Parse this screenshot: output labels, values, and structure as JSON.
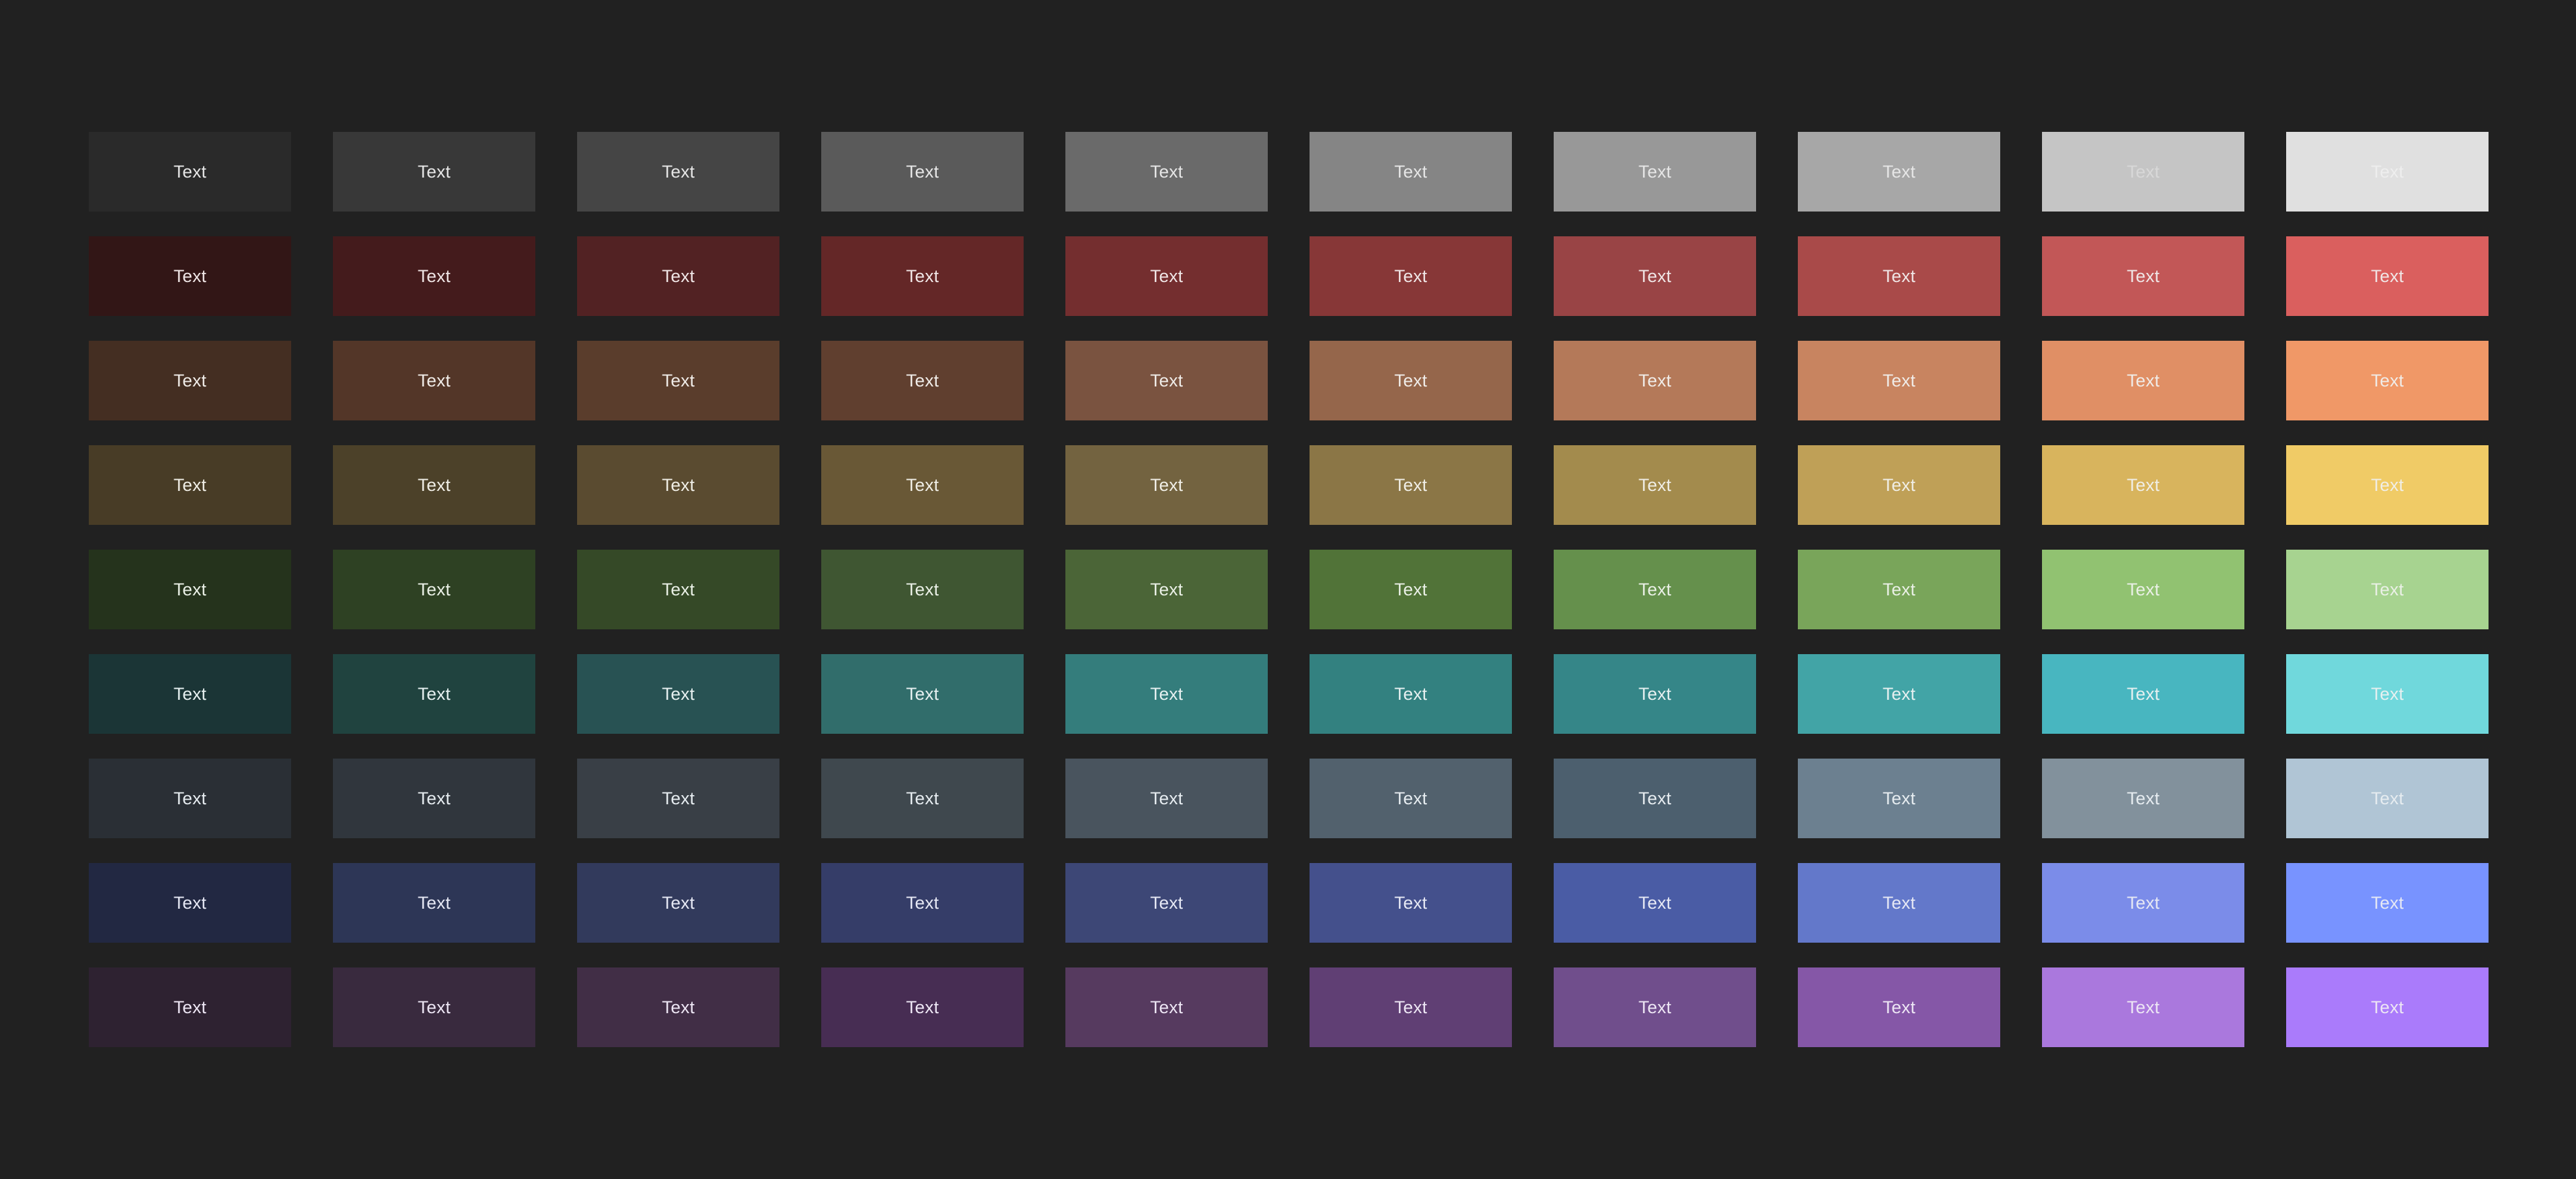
{
  "swatch_label": "Text",
  "rows": [
    {
      "text_color": "#e6e6e6",
      "colors": [
        "#2a2a2a",
        "#383838",
        "#454545",
        "#5a5a5a",
        "#6a6a6a",
        "#858585",
        "#989898",
        "#a7a7a7"
      ],
      "last_text_colors": [
        "#d8d8d8",
        "#eeeeee"
      ],
      "last_colors": [
        "#c5c5c5",
        "#e0e0e0"
      ]
    },
    {
      "text_color": "#f0e6e6",
      "colors": [
        "#321616",
        "#441b1c",
        "#522223",
        "#642727",
        "#742e2f",
        "#873737",
        "#994445",
        "#a94a49",
        "#c25757",
        "#da5f5e"
      ]
    },
    {
      "text_color": "#f0ece8",
      "colors": [
        "#442e22",
        "#533628",
        "#5a3d2c",
        "#603f2f",
        "#7a5340",
        "#95664b",
        "#b47959",
        "#c88460",
        "#e08f65",
        "#f09867"
      ]
    },
    {
      "text_color": "#f0eee6",
      "colors": [
        "#483c26",
        "#4c4129",
        "#5a4b30",
        "#695836",
        "#736340",
        "#8b7646",
        "#a38b4d",
        "#bfa057",
        "#d8b45d",
        "#f0cb66"
      ]
    },
    {
      "text_color": "#eaf0e6",
      "colors": [
        "#25331c",
        "#2e4123",
        "#354927",
        "#3f5632",
        "#4b6537",
        "#517338",
        "#65904c",
        "#79a55a",
        "#91c271",
        "#a7d390"
      ]
    },
    {
      "text_color": "#e6f0f0",
      "colors": [
        "#1b3536",
        "#20433f",
        "#285253",
        "#316d6b",
        "#347d7c",
        "#338180",
        "#358688",
        "#42a4a6",
        "#48b6c0",
        "#70d8dc"
      ]
    },
    {
      "text_color": "#e6ecf0",
      "colors": [
        "#2a2f35",
        "#30363d",
        "#393f46",
        "#3f484e",
        "#49545e",
        "#52616d",
        "#4c5f6e",
        "#6c8090",
        "#82919c",
        "#b0c5d5"
      ]
    },
    {
      "text_color": "#e6e8f4",
      "colors": [
        "#222842",
        "#2d3656",
        "#323a5c",
        "#353d68",
        "#3d4776",
        "#44508c",
        "#4a5ca5",
        "#6378ca",
        "#7b8ce9",
        "#7893ff"
      ]
    },
    {
      "text_color": "#ede6f4",
      "colors": [
        "#2e2231",
        "#392a3e",
        "#412e46",
        "#472d53",
        "#563a5f",
        "#603f74",
        "#704e8c",
        "#8557a7",
        "#aa78dd",
        "#aa7bfb"
      ]
    }
  ]
}
